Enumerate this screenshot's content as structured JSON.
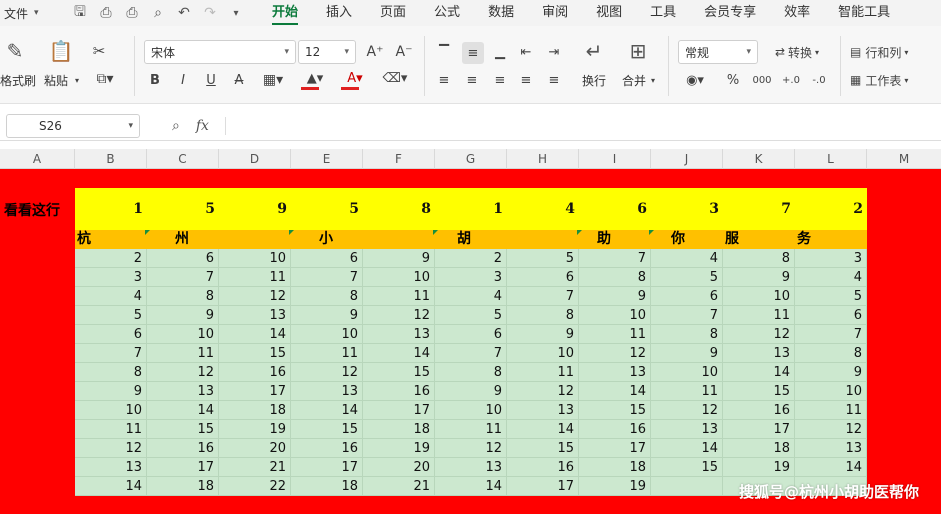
{
  "menu": {
    "file_label": "文件",
    "tabs": [
      "开始",
      "插入",
      "页面",
      "公式",
      "数据",
      "审阅",
      "视图",
      "工具",
      "会员专享",
      "效率",
      "智能工具"
    ],
    "active_tab": "开始"
  },
  "ribbon": {
    "format_painter_label": "格式刷",
    "paste_label": "粘贴",
    "font_name": "宋体",
    "font_size": "12",
    "wrap_label": "换行",
    "merge_label": "合并",
    "number_format": "常规",
    "convert_label": "转换",
    "rows_cols_label": "行和列",
    "worksheet_label": "工作表",
    "bold": "B",
    "italic": "I",
    "underline": "U",
    "strike": "A",
    "percent": "%",
    "thousands": "000",
    "inc_decimal": "+.0",
    "dec_decimal": "-.0"
  },
  "formula_bar": {
    "name_box": "S26",
    "fx_label": "fx",
    "formula": ""
  },
  "columns": [
    "A",
    "B",
    "C",
    "D",
    "E",
    "F",
    "G",
    "H",
    "I",
    "J",
    "K",
    "L",
    "M"
  ],
  "sheet": {
    "row_label": "看看这行",
    "yellow_row": [
      "1",
      "5",
      "9",
      "5",
      "8",
      "1",
      "4",
      "6",
      "3",
      "7",
      "2"
    ],
    "orange_row": [
      "杭",
      "州",
      "小",
      "胡",
      "助",
      "你",
      "服",
      "务"
    ],
    "green_rows": [
      [
        "2",
        "6",
        "10",
        "6",
        "9",
        "2",
        "5",
        "7",
        "4",
        "8",
        "3"
      ],
      [
        "3",
        "7",
        "11",
        "7",
        "10",
        "3",
        "6",
        "8",
        "5",
        "9",
        "4"
      ],
      [
        "4",
        "8",
        "12",
        "8",
        "11",
        "4",
        "7",
        "9",
        "6",
        "10",
        "5"
      ],
      [
        "5",
        "9",
        "13",
        "9",
        "12",
        "5",
        "8",
        "10",
        "7",
        "11",
        "6"
      ],
      [
        "6",
        "10",
        "14",
        "10",
        "13",
        "6",
        "9",
        "11",
        "8",
        "12",
        "7"
      ],
      [
        "7",
        "11",
        "15",
        "11",
        "14",
        "7",
        "10",
        "12",
        "9",
        "13",
        "8"
      ],
      [
        "8",
        "12",
        "16",
        "12",
        "15",
        "8",
        "11",
        "13",
        "10",
        "14",
        "9"
      ],
      [
        "9",
        "13",
        "17",
        "13",
        "16",
        "9",
        "12",
        "14",
        "11",
        "15",
        "10"
      ],
      [
        "10",
        "14",
        "18",
        "14",
        "17",
        "10",
        "13",
        "15",
        "12",
        "16",
        "11"
      ],
      [
        "11",
        "15",
        "19",
        "15",
        "18",
        "11",
        "14",
        "16",
        "13",
        "17",
        "12"
      ],
      [
        "12",
        "16",
        "20",
        "16",
        "19",
        "12",
        "15",
        "17",
        "14",
        "18",
        "13"
      ],
      [
        "13",
        "17",
        "21",
        "17",
        "20",
        "13",
        "16",
        "18",
        "15",
        "19",
        "14"
      ],
      [
        "14",
        "18",
        "22",
        "18",
        "21",
        "14",
        "17",
        "19",
        "",
        "",
        ""
      ]
    ]
  },
  "watermark": "搜狐号@杭州小胡助医帮你",
  "colors": {
    "sheet_bg": "#ff0000",
    "yellow_row": "#ffff00",
    "orange_row": "#ffc000",
    "green_cells": "#cce8cf",
    "accent": "#0b7a3b"
  }
}
